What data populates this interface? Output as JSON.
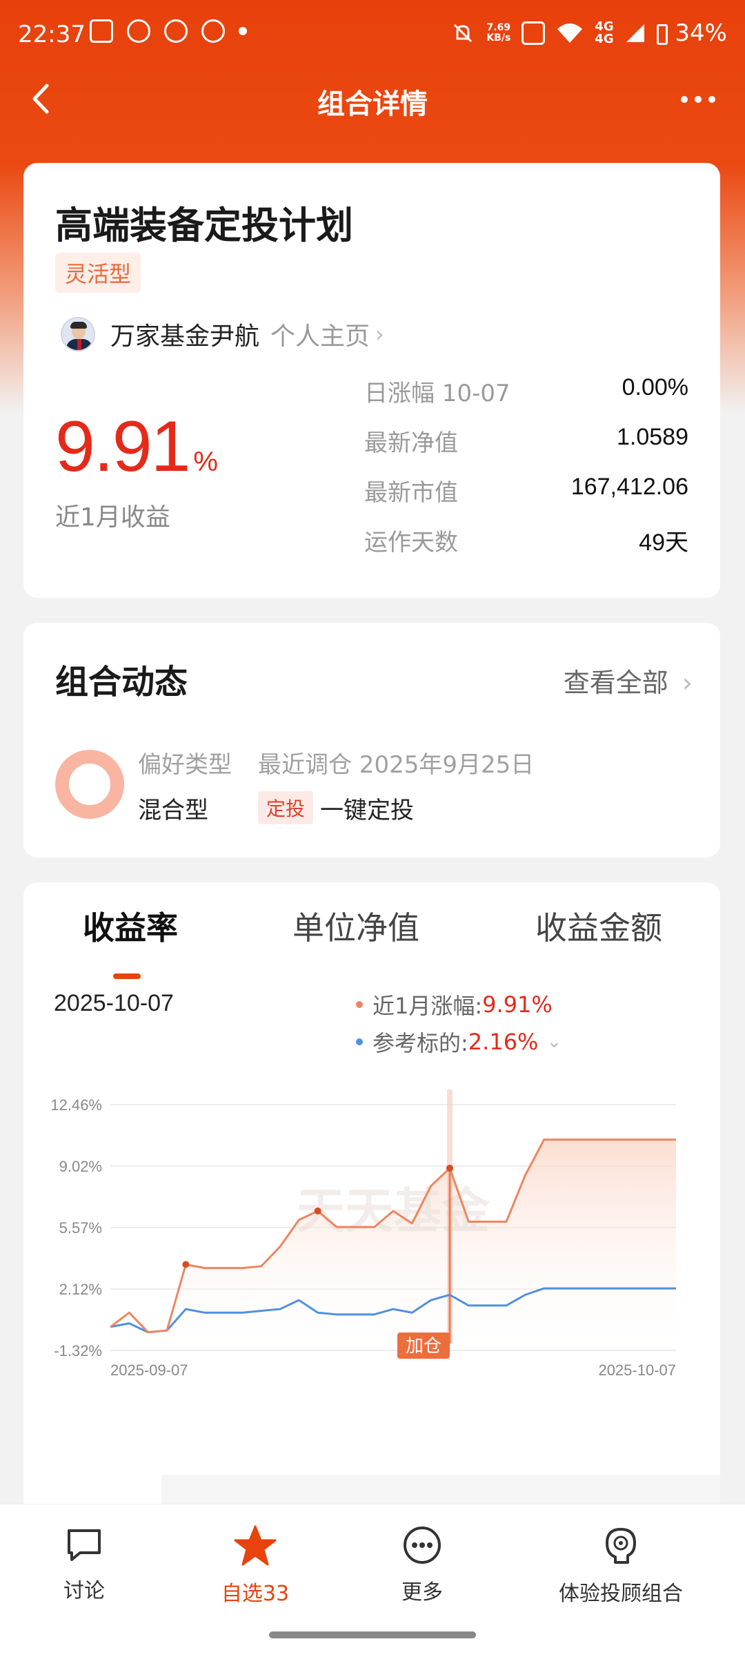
{
  "status_bar": {
    "time": "22:37",
    "net_speed_top": "7.69",
    "net_speed_bottom": "KB/s",
    "network": "4G",
    "battery": "34%"
  },
  "header": {
    "title": "组合详情"
  },
  "plan": {
    "title": "高端装备定投计划",
    "type_tag": "灵活型",
    "manager_name": "万家基金尹航",
    "manager_link": "个人主页",
    "return_value": "9.91",
    "return_unit": "%",
    "return_label": "近1月收益",
    "stats": [
      {
        "label": "日涨幅 10-07",
        "value": "0.00%"
      },
      {
        "label": "最新净值",
        "value": "1.0589"
      },
      {
        "label": "最新市值",
        "value": "167,412.06"
      },
      {
        "label": "运作天数",
        "value": "49天"
      }
    ]
  },
  "dynamics": {
    "title": "组合动态",
    "view_all": "查看全部",
    "pref_label": "偏好类型",
    "pref_value": "混合型",
    "adjust_label": "最近调仓 2025年9月25日",
    "dt_tag": "定投",
    "dt_text": "一键定投"
  },
  "chart_section": {
    "tabs": [
      "收益率",
      "单位净值",
      "收益金额"
    ],
    "date": "2025-10-07",
    "legend": [
      {
        "label": "近1月涨幅:",
        "value": "9.91%",
        "color": "#ee8560"
      },
      {
        "label": "参考标的:",
        "value": "2.16%",
        "color": "#4f90e0"
      }
    ],
    "watermark": "天天基金",
    "marker_label": "加仓"
  },
  "chart_data": {
    "type": "line",
    "xlabel": "",
    "ylabel": "",
    "x_ticks": [
      "2025-09-07",
      "2025-10-07"
    ],
    "y_ticks": [
      "12.46%",
      "9.02%",
      "5.57%",
      "2.12%",
      "-1.32%"
    ],
    "ylim": [
      -1.32,
      12.46
    ],
    "grid": true,
    "series": [
      {
        "name": "近1月涨幅",
        "color": "#ee8560",
        "values": [
          0.0,
          0.8,
          -0.3,
          -0.2,
          3.5,
          3.3,
          3.3,
          3.3,
          3.4,
          4.5,
          6.0,
          6.5,
          5.6,
          5.6,
          5.6,
          6.5,
          5.8,
          7.9,
          8.9,
          5.9,
          5.9,
          5.9,
          8.5,
          10.5,
          10.5,
          10.5,
          10.5,
          10.5,
          10.5,
          10.5,
          10.5
        ],
        "marked_indices": [
          4,
          11,
          18
        ]
      },
      {
        "name": "参考标的",
        "color": "#4f90e0",
        "values": [
          0.0,
          0.2,
          -0.3,
          -0.2,
          1.0,
          0.8,
          0.8,
          0.8,
          0.9,
          1.0,
          1.5,
          0.8,
          0.7,
          0.7,
          0.7,
          1.0,
          0.8,
          1.5,
          1.8,
          1.2,
          1.2,
          1.2,
          1.8,
          2.16,
          2.16,
          2.16,
          2.16,
          2.16,
          2.16,
          2.16,
          2.16
        ]
      }
    ],
    "marker_index": 18
  },
  "bottom_nav": [
    {
      "label": "讨论",
      "icon": "chat-icon"
    },
    {
      "label": "自选33",
      "icon": "star-icon"
    },
    {
      "label": "更多",
      "icon": "more-icon"
    },
    {
      "label": "体验投顾组合",
      "icon": "advisor-icon"
    }
  ]
}
